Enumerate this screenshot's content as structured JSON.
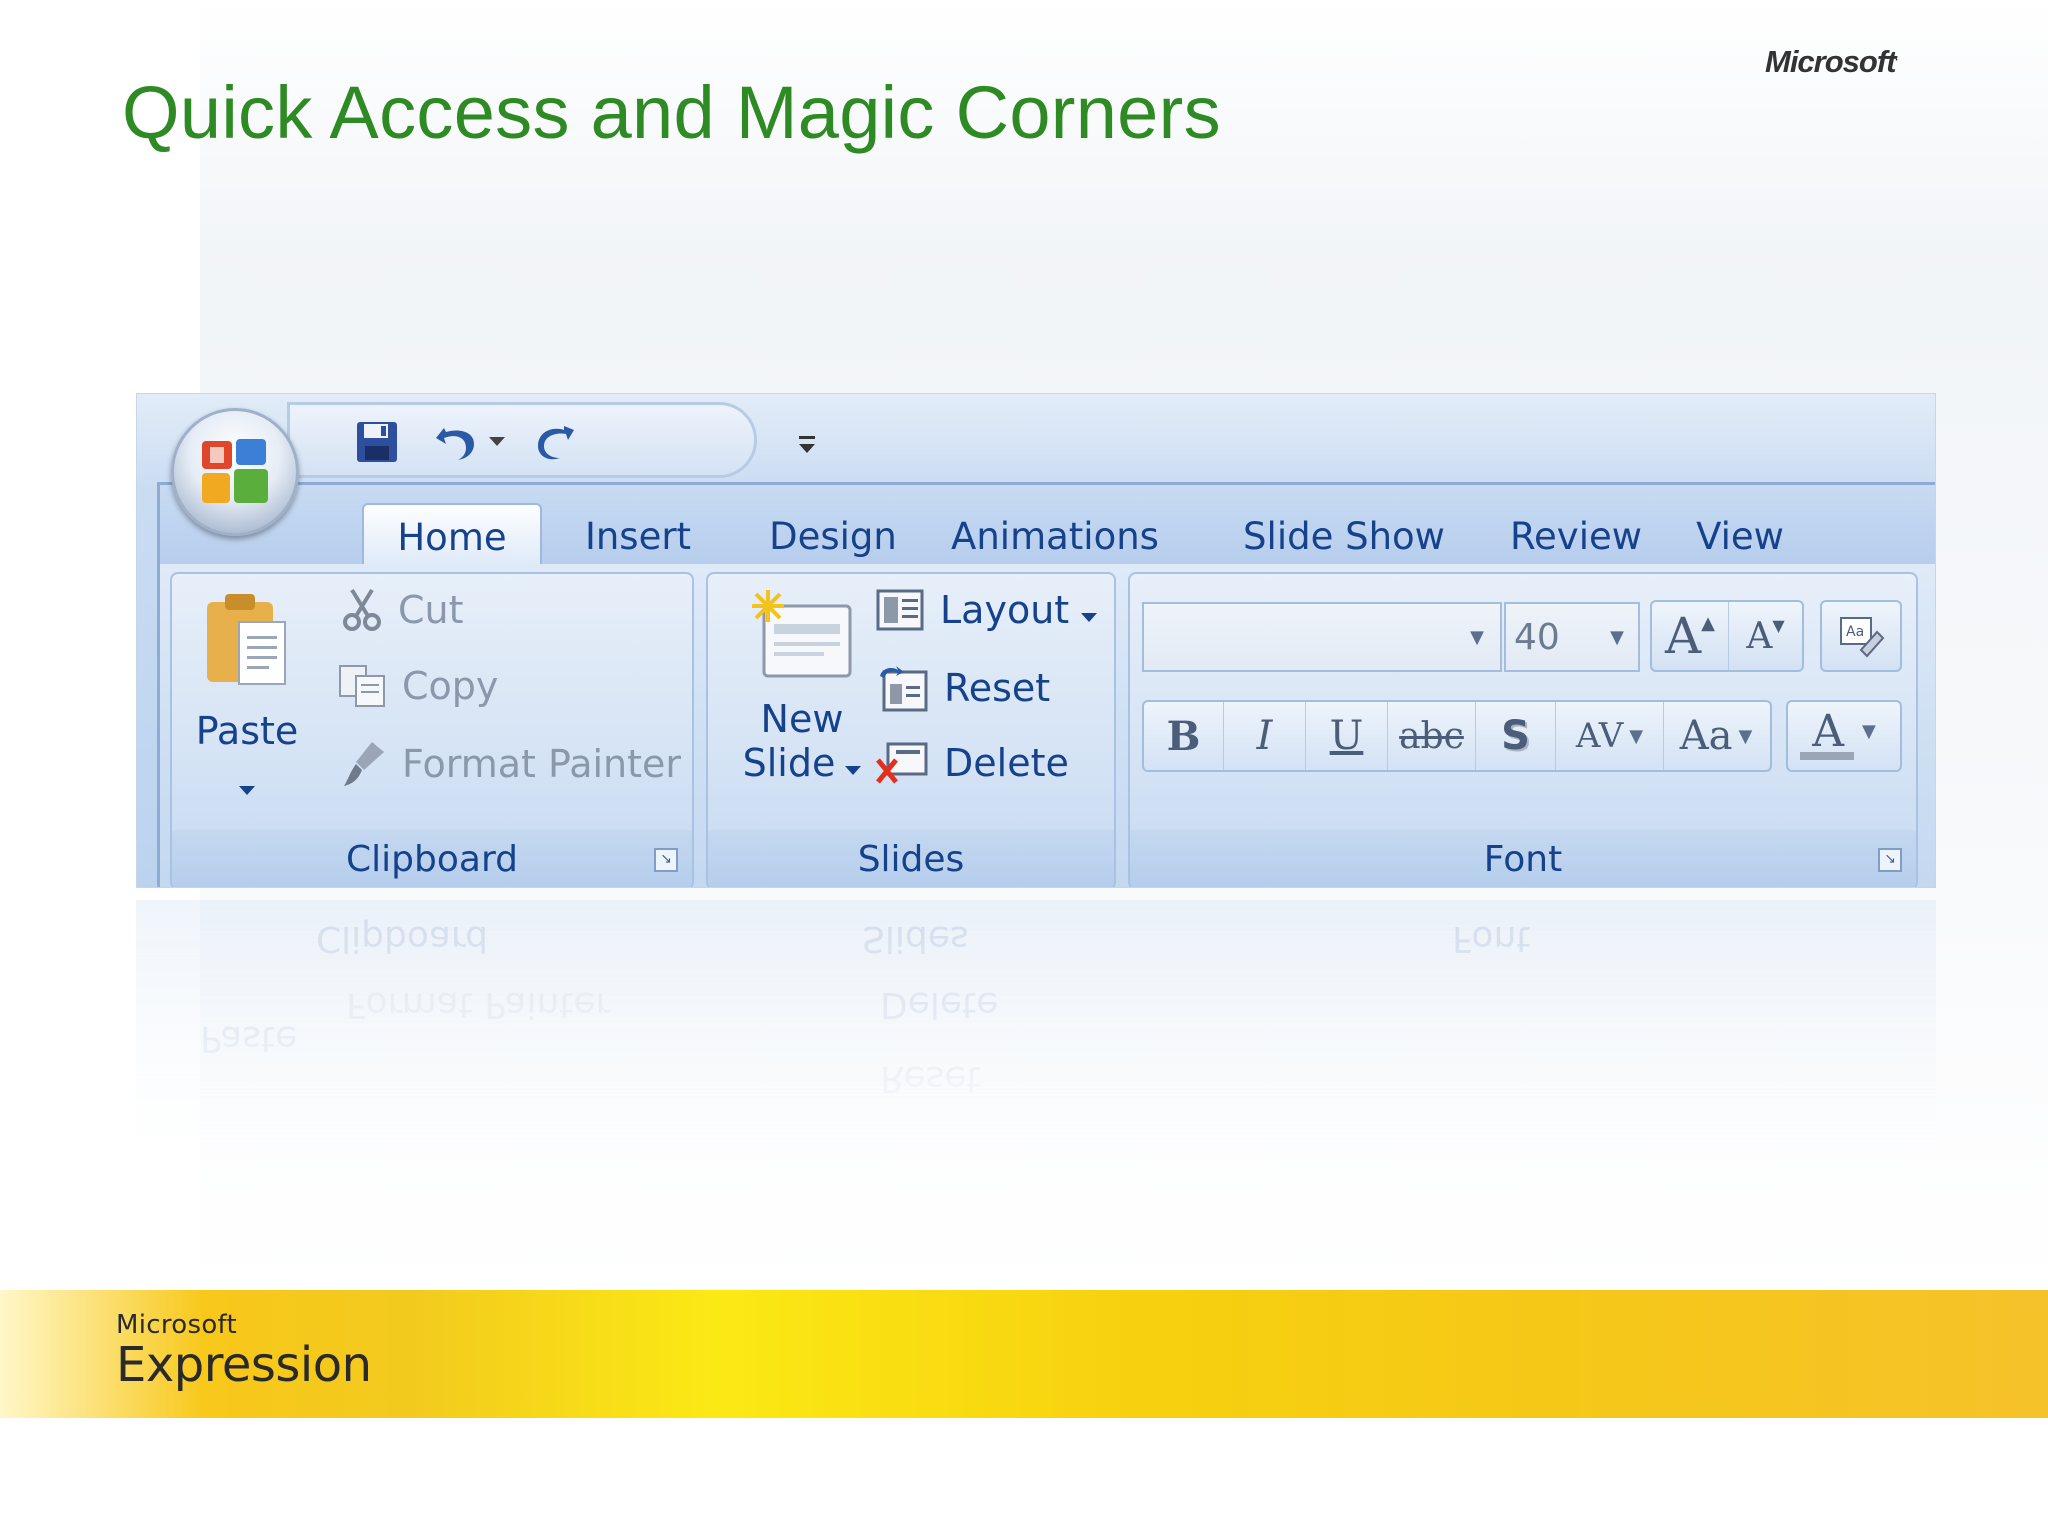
{
  "slide": {
    "title": "Quick Access and Magic Corners",
    "corner_logo": "Microsoft",
    "footer_brand_small": "Microsoft",
    "footer_brand_large": "Expression"
  },
  "ribbon": {
    "office_button_icon": "office-logo-icon",
    "quick_access": {
      "items": [
        "save-icon",
        "undo-icon",
        "undo-dropdown-icon",
        "redo-icon"
      ],
      "customize_icon": "customize-qat-icon"
    },
    "tabs": [
      {
        "label": "Home",
        "active": true
      },
      {
        "label": "Insert",
        "active": false
      },
      {
        "label": "Design",
        "active": false
      },
      {
        "label": "Animations",
        "active": false
      },
      {
        "label": "Slide Show",
        "active": false
      },
      {
        "label": "Review",
        "active": false
      },
      {
        "label": "View",
        "active": false
      }
    ],
    "clipboard": {
      "label": "Clipboard",
      "paste": "Paste",
      "cut": "Cut",
      "copy": "Copy",
      "format_painter": "Format Painter"
    },
    "slides": {
      "label": "Slides",
      "new_slide_line1": "New",
      "new_slide_line2": "Slide",
      "layout": "Layout",
      "reset": "Reset",
      "delete": "Delete"
    },
    "font": {
      "label": "Font",
      "font_name_value": "",
      "font_size_value": "40",
      "grow_label": "A",
      "shrink_label": "A",
      "bold": "B",
      "italic": "I",
      "underline": "U",
      "strikethrough": "abc",
      "shadow": "S",
      "spacing": "AV",
      "change_case": "Aa",
      "font_color": "A"
    }
  },
  "colors": {
    "title_green": "#2e8b24",
    "ribbon_text": "#15428b",
    "band_yellow": "#f8c81a"
  }
}
